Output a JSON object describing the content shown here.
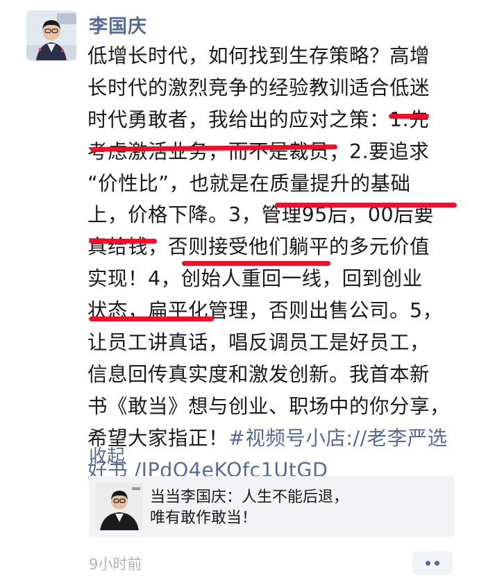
{
  "post": {
    "author": "李国庆",
    "lines": [
      "低增长时代，如何找到生存策略？高增",
      "长时代的激烈竞争的经验教训适合低迷",
      "时代勇敢者，我给出的应对之策：1.先",
      "考虑激活业务，而不是裁员；2.要追求",
      "“价性比”，也就是在质量提升的基础",
      "上，价格下降。3，管理95后，00后要",
      "真给钱，否则接受他们躺平的多元价值",
      "实现！4，创始人重回一线，回到创业",
      "状态，扁平化管理，否则出售公司。5，",
      "让员工讲真话，唱反调员工是好员工，",
      "信息回传真实度和激发创新。我首本新",
      "书《敢当》想与创业、职场中的你分享，"
    ],
    "line_13_text": "希望大家指正！",
    "hashtag_part1": "#视频号小店://老李严选",
    "hashtag_part2": "好书 /IPdO4eKOfc1UtGD",
    "collapse_label": "收起",
    "share_card": {
      "line1": "当当李国庆：人生不能后退，",
      "line2": "唯有敢作敢当！"
    },
    "timestamp": "9小时前"
  },
  "colors": {
    "link": "#576b95",
    "underline": "#e8132a",
    "card_bg": "#f3f3f5",
    "time": "#b2b2b2"
  },
  "icons": {
    "avatar": "author-avatar",
    "share_thumbnail": "share-thumbnail",
    "more": "more-icon"
  }
}
